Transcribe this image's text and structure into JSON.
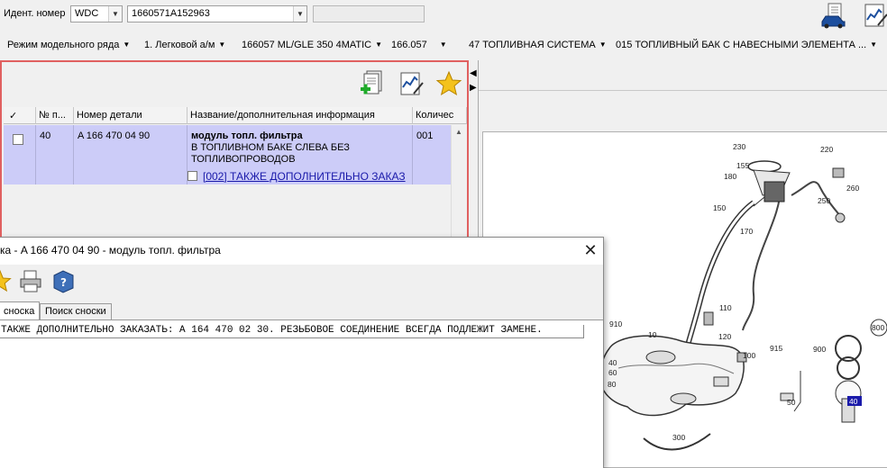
{
  "toolbar": {
    "ident_label": "Идент. номер",
    "ident_prefix": "WDC",
    "ident_value": "1660571A152963",
    "extra_field": ""
  },
  "breadcrumbs": [
    {
      "label": "Режим модельного ряда"
    },
    {
      "label": "1. Легковой а/м"
    },
    {
      "label": "166057 ML/GLE 350 4MATIC"
    },
    {
      "label": "166.057"
    },
    {
      "label": "47 ТОПЛИВНАЯ СИСТЕМА"
    },
    {
      "label": "015 ТОПЛИВНЫЙ БАК С НАВЕСНЫМИ ЭЛЕМЕНТА ..."
    }
  ],
  "parts_table": {
    "columns": [
      "✓",
      "№ п...",
      "Номер детали",
      "Название/дополнительная информация",
      "Количес"
    ],
    "rows": [
      {
        "checked": false,
        "pos": "40",
        "part_number": "A 166 470 04 90",
        "name_bold": "модуль топл. фильтра",
        "name_line2": "В ТОПЛИВНОМ БАКЕ СЛЕВА БЕЗ",
        "name_line3": "ТОПЛИВОПРОВОДОВ",
        "note_link": "[002] ТАКЖЕ ДОПОЛНИТЕЛЬНО ЗАКАЗ",
        "qty": "001"
      }
    ]
  },
  "footnote_dialog": {
    "title": "ка - A 166 470 04 90 - модуль топл. фильтра",
    "tabs": [
      "сноска",
      "Поиск сноски"
    ],
    "active_tab": 0,
    "text": "ТАКЖЕ ДОПОЛНИТЕЛЬНО ЗАКАЗАТЬ: A 164 470 02 30. РЕЗЬБОВОЕ СОЕДИНЕНИЕ ВСЕГДА ПОДЛЕЖИТ ЗАМЕНЕ."
  },
  "diagram": {
    "callouts": [
      "190",
      "210",
      "230",
      "220",
      "155",
      "180",
      "260",
      "250",
      "150",
      "170",
      "110",
      "910",
      "10",
      "120",
      "100",
      "915",
      "800",
      "900",
      "40",
      "60",
      "80",
      "50",
      "300"
    ],
    "highlight_callout": "40",
    "highlight_color": "#1a1aaa"
  },
  "colors": {
    "selected_row": "#ccccf8",
    "pane_border": "#e06060",
    "link": "#1a1aaa"
  }
}
